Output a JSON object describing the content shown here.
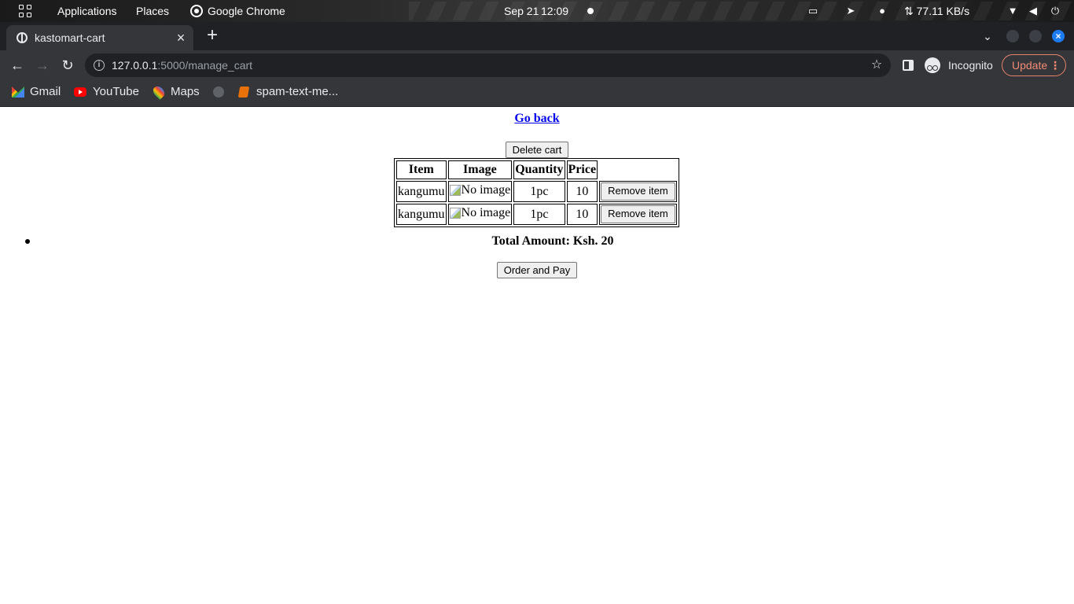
{
  "system_bar": {
    "applications_label": "Applications",
    "places_label": "Places",
    "active_app_label": "Google Chrome",
    "date": "Sep 21",
    "time": "12:09",
    "network_speed": "⇅ 77.11 KB/s"
  },
  "browser": {
    "tab_title": "kastomart-cart",
    "url_host": "127.0.0.1",
    "url_path": ":5000/manage_cart",
    "profile_label": "Incognito",
    "update_label": "Update",
    "bookmarks": [
      {
        "label": "Gmail",
        "icon": "gmail-icon"
      },
      {
        "label": "YouTube",
        "icon": "youtube-icon"
      },
      {
        "label": "Maps",
        "icon": "maps-icon"
      },
      {
        "label": "",
        "icon": "globe-icon"
      },
      {
        "label": "spam-text-me...",
        "icon": "book-icon"
      }
    ]
  },
  "page": {
    "go_back_label": "Go back",
    "delete_cart_label": "Delete cart",
    "table": {
      "headers": [
        "Item",
        "Image",
        "Quantity",
        "Price"
      ],
      "rows": [
        {
          "item": "kangumu",
          "image_alt": "No image",
          "quantity": "1pc",
          "price": "10",
          "action": "Remove item"
        },
        {
          "item": "kangumu",
          "image_alt": "No image",
          "quantity": "1pc",
          "price": "10",
          "action": "Remove item"
        }
      ]
    },
    "total_label": "Total Amount: Ksh. 20",
    "order_pay_label": "Order and Pay"
  },
  "colors": {
    "link": "#0000ee",
    "update_accent": "#f28b76",
    "window_close": "#1c7cf4"
  }
}
